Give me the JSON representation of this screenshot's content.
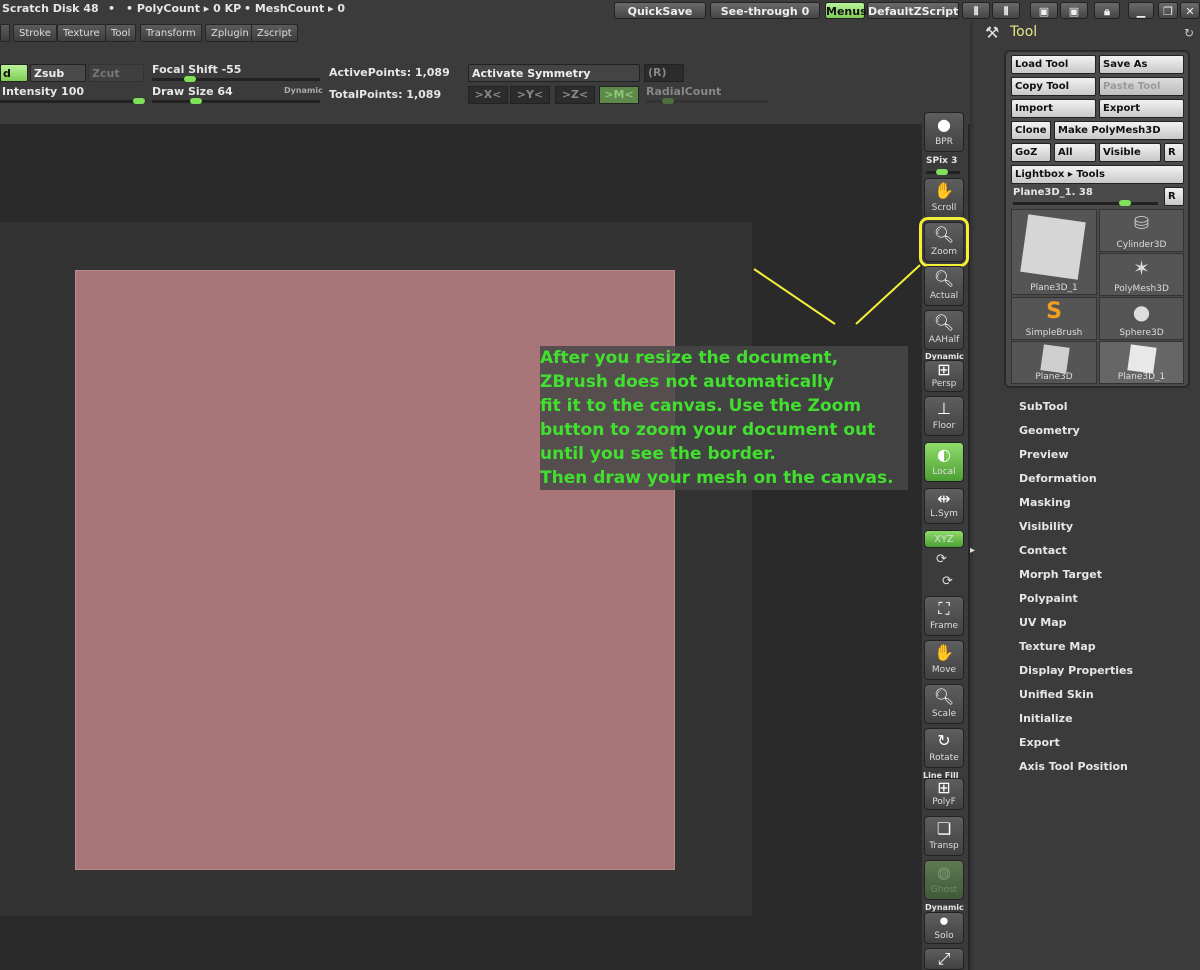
{
  "topbar": {
    "scratch_disk": "Scratch Disk 48",
    "polycount": "• PolyCount ▸ 0  KP",
    "meshcount": "• MeshCount ▸ 0",
    "quicksave": "QuickSave",
    "seethrough": "See-through   0",
    "menus": "Menus",
    "script": "DefaultZScript"
  },
  "menus": [
    "Stroke",
    "Texture",
    "Tool",
    "Transform",
    "Zplugin",
    "Zscript"
  ],
  "brush_bar": {
    "draw_label": "d",
    "zsub": "Zsub",
    "zcut": "Zcut",
    "intensity": "Intensity 100",
    "focal_shift": "Focal Shift -55",
    "draw_size": "Draw Size 64",
    "dynamic": "Dynamic",
    "active_points": "ActivePoints: 1,089",
    "total_points": "TotalPoints: 1,089",
    "activate_symmetry": "Activate Symmetry",
    "r": "(R)",
    "sym_x": ">X<",
    "sym_y": ">Y<",
    "sym_z": ">Z<",
    "sym_m": ">M<",
    "radial_count": "RadialCount"
  },
  "callout": {
    "lines": [
      "After you resize the document,",
      "ZBrush does not automatically",
      "fit it to the canvas. Use the Zoom",
      "button to zoom your document out",
      "until you see the border.",
      "Then draw your mesh on the canvas."
    ],
    "color": "#41e02e"
  },
  "shelf": {
    "bpr": "BPR",
    "spix": "SPix 3",
    "scroll": "Scroll",
    "zoom": "Zoom",
    "actual": "Actual",
    "aahalf": "AAHalf",
    "dynamic": "Dynamic",
    "persp": "Persp",
    "floor": "Floor",
    "local": "Local",
    "lsym": "L.Sym",
    "xyz": "XYZ",
    "frame": "Frame",
    "move": "Move",
    "scale": "Scale",
    "rotate": "Rotate",
    "line_fill": "Line Fill",
    "polyf": "PolyF",
    "transp": "Transp",
    "ghost": "Ghost",
    "dynamic2": "Dynamic",
    "solo": "Solo"
  },
  "tool_palette": {
    "title": "Tool",
    "load_tool": "Load Tool",
    "save_as": "Save As",
    "copy_tool": "Copy Tool",
    "paste_tool": "Paste Tool",
    "import": "Import",
    "export": "Export",
    "clone": "Clone",
    "make_polymesh": "Make PolyMesh3D",
    "goz": "GoZ",
    "all": "All",
    "visible": "Visible",
    "r": "R",
    "lightbox": "Lightbox ▸ Tools",
    "current_tool": "Plane3D_1. 38",
    "thumbs": [
      "Plane3D_1",
      "Cylinder3D",
      "PolyMesh3D",
      "SimpleBrush",
      "Sphere3D",
      "Plane3D",
      "Plane3D_1"
    ],
    "sections": [
      "SubTool",
      "Geometry",
      "Preview",
      "Deformation",
      "Masking",
      "Visibility",
      "Contact",
      "Morph Target",
      "Polypaint",
      "UV Map",
      "Texture Map",
      "Display Properties",
      "Unified Skin",
      "Initialize",
      "Export",
      "Axis Tool Position"
    ]
  }
}
